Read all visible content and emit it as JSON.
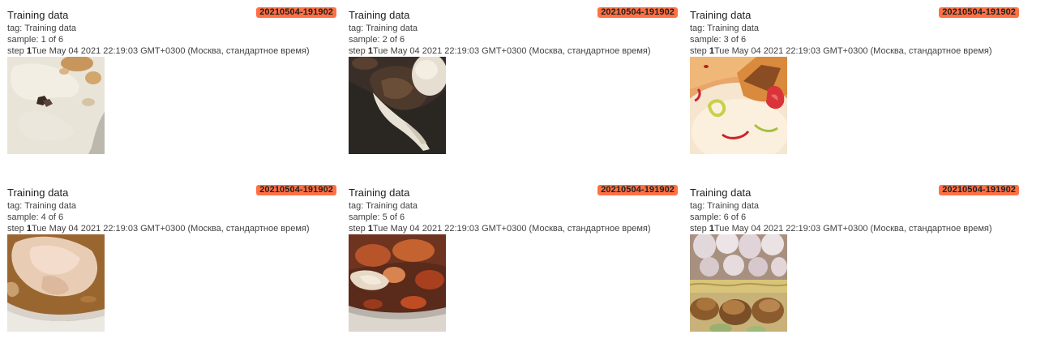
{
  "cards": [
    {
      "title": "Training data",
      "run": "20210504-191902",
      "tag": "tag: Training data",
      "sample": "sample: 1 of 6",
      "step_prefix": "step ",
      "step_value": "1",
      "timestamp": "Tue May 04 2021 22:19:03 GMT+0300 (Москва, стандартное время)"
    },
    {
      "title": "Training data",
      "run": "20210504-191902",
      "tag": "tag: Training data",
      "sample": "sample: 2 of 6",
      "step_prefix": "step ",
      "step_value": "1",
      "timestamp": "Tue May 04 2021 22:19:03 GMT+0300 (Москва, стандартное время)"
    },
    {
      "title": "Training data",
      "run": "20210504-191902",
      "tag": "tag: Training data",
      "sample": "sample: 3 of 6",
      "step_prefix": "step ",
      "step_value": "1",
      "timestamp": "Tue May 04 2021 22:19:03 GMT+0300 (Москва, стандартное время)"
    },
    {
      "title": "Training data",
      "run": "20210504-191902",
      "tag": "tag: Training data",
      "sample": "sample: 4 of 6",
      "step_prefix": "step ",
      "step_value": "1",
      "timestamp": "Tue May 04 2021 22:19:03 GMT+0300 (Москва, стандартное время)"
    },
    {
      "title": "Training data",
      "run": "20210504-191902",
      "tag": "tag: Training data",
      "sample": "sample: 5 of 6",
      "step_prefix": "step ",
      "step_value": "1",
      "timestamp": "Tue May 04 2021 22:19:03 GMT+0300 (Москва, стандартное время)"
    },
    {
      "title": "Training data",
      "run": "20210504-191902",
      "tag": "tag: Training data",
      "sample": "sample: 6 of 6",
      "step_prefix": "step ",
      "step_value": "1",
      "timestamp": "Tue May 04 2021 22:19:03 GMT+0300 (Москва, стандартное время)"
    }
  ],
  "colors": {
    "run_badge": "#ff7043",
    "text_primary": "#212121",
    "text_secondary": "#424242",
    "background": "#ffffff"
  }
}
